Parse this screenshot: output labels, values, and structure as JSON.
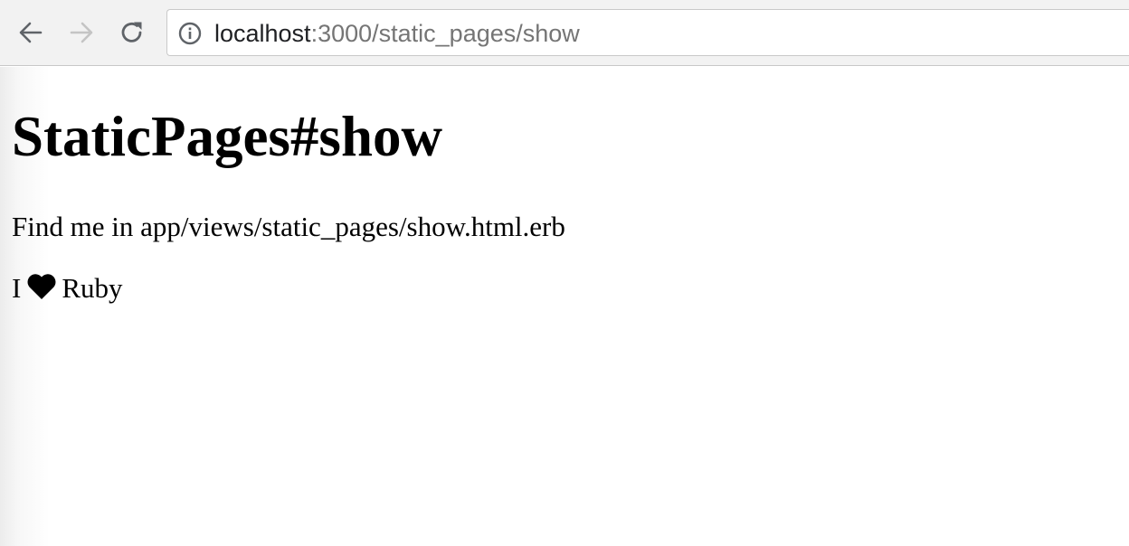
{
  "browser": {
    "url_host": "localhost",
    "url_path": ":3000/static_pages/show"
  },
  "page": {
    "heading": "StaticPages#show",
    "paragraph_1": "Find me in app/views/static_pages/show.html.erb",
    "paragraph_2_before": "I",
    "paragraph_2_icon": "heart-icon",
    "paragraph_2_after": "Ruby"
  },
  "colors": {
    "toolbar_bg": "#f2f2f2",
    "url_host": "#202124",
    "url_path": "#757575",
    "text": "#000000"
  }
}
